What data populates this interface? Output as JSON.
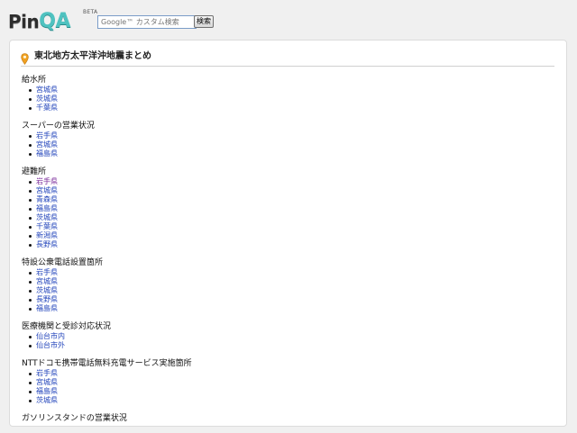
{
  "header": {
    "logo_pin": "Pin",
    "logo_qa": "QA",
    "beta": "BETA",
    "search_placeholder": "Google™ カスタム検索",
    "search_button": "検索"
  },
  "page": {
    "title": "東北地方太平洋沖地震まとめ"
  },
  "sections": [
    {
      "heading": "給水所",
      "items": [
        "宮城県",
        "茨城県",
        "千葉県"
      ]
    },
    {
      "heading": "スーパーの営業状況",
      "items": [
        "岩手県",
        "宮城県",
        "福島県"
      ]
    },
    {
      "heading": "避難所",
      "items": [
        "岩手県",
        "宮城県",
        "青森県",
        "福島県",
        "茨城県",
        "千葉県",
        "新潟県",
        "長野県"
      ]
    },
    {
      "heading": "特設公衆電話設置箇所",
      "items": [
        "岩手県",
        "宮城県",
        "茨城県",
        "長野県",
        "福島県"
      ]
    },
    {
      "heading": "医療機関と受診対応状況",
      "items": [
        "仙台市内",
        "仙台市外"
      ]
    },
    {
      "heading": "NTTドコモ携帯電話無料充電サービス実施箇所",
      "items": [
        "岩手県",
        "宮城県",
        "福島県",
        "茨城県"
      ]
    },
    {
      "heading": "ガソリンスタンドの営業状況",
      "items": []
    }
  ],
  "colors": {
    "link": "#2244bb",
    "visited_link": "#7a2a9a",
    "logo_accent": "#4fc2c0",
    "pin_icon": "#f0a020"
  }
}
